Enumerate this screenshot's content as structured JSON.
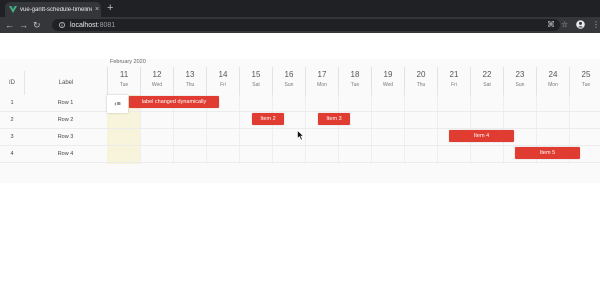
{
  "browser": {
    "tab_title": "vue-gantt-schedule-timeline-c",
    "tab_close": "×",
    "new_tab": "+",
    "url_host": "localhost",
    "url_port": ":8081",
    "back": "←",
    "forward": "→",
    "reload": "↻",
    "translate": "⌘",
    "star": "☆",
    "menu": "⋮"
  },
  "gantt": {
    "month": "February 2020",
    "id_header": "ID",
    "label_header": "Label",
    "toggle_icon": "‹≡",
    "days": [
      {
        "num": "11",
        "name": "Tue"
      },
      {
        "num": "12",
        "name": "Wed"
      },
      {
        "num": "13",
        "name": "Thu"
      },
      {
        "num": "14",
        "name": "Fri"
      },
      {
        "num": "15",
        "name": "Sat"
      },
      {
        "num": "16",
        "name": "Sun"
      },
      {
        "num": "17",
        "name": "Mon"
      },
      {
        "num": "18",
        "name": "Tue"
      },
      {
        "num": "19",
        "name": "Wed"
      },
      {
        "num": "20",
        "name": "Thu"
      },
      {
        "num": "21",
        "name": "Fri"
      },
      {
        "num": "22",
        "name": "Sat"
      },
      {
        "num": "23",
        "name": "Sun"
      },
      {
        "num": "24",
        "name": "Mon"
      },
      {
        "num": "25",
        "name": "Tue"
      }
    ],
    "rows": [
      {
        "id": "1",
        "label": "Row 1"
      },
      {
        "id": "2",
        "label": "Row 2"
      },
      {
        "id": "3",
        "label": "Row 3"
      },
      {
        "id": "4",
        "label": "Row 4"
      }
    ],
    "items": [
      {
        "label": "label changed dynamically"
      },
      {
        "label": "Item 2"
      },
      {
        "label": "Item 3"
      },
      {
        "label": "Item 4"
      },
      {
        "label": "Item 5"
      }
    ],
    "colors": {
      "item": "#e03c31",
      "today": "#f8f4dc"
    }
  }
}
